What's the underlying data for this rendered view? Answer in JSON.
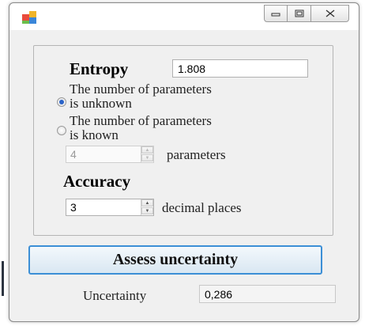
{
  "window": {
    "icons": {
      "app": "form-icon",
      "minimize": "minimize-icon",
      "maximize": "maximize-icon",
      "close": "close-icon"
    }
  },
  "entropy": {
    "heading": "Entropy",
    "value": "1.808"
  },
  "parameters": {
    "option_unknown": "The number of parameters is unknown",
    "option_unknown_line1": "The number of parameters",
    "option_unknown_line2": "is unknown",
    "option_known_line1": "The number of parameters",
    "option_known_line2": "is known",
    "selected": "unknown",
    "count": "4",
    "count_label": "parameters"
  },
  "accuracy": {
    "heading": "Accuracy",
    "value": "3",
    "label": "decimal places"
  },
  "assess_button": "Assess uncertainty",
  "uncertainty": {
    "label": "Uncertainty",
    "value": "0,286"
  },
  "colors": {
    "accent": "#3c8fd6",
    "radio_selected": "#2a63c8",
    "background": "#f0f0f0"
  }
}
